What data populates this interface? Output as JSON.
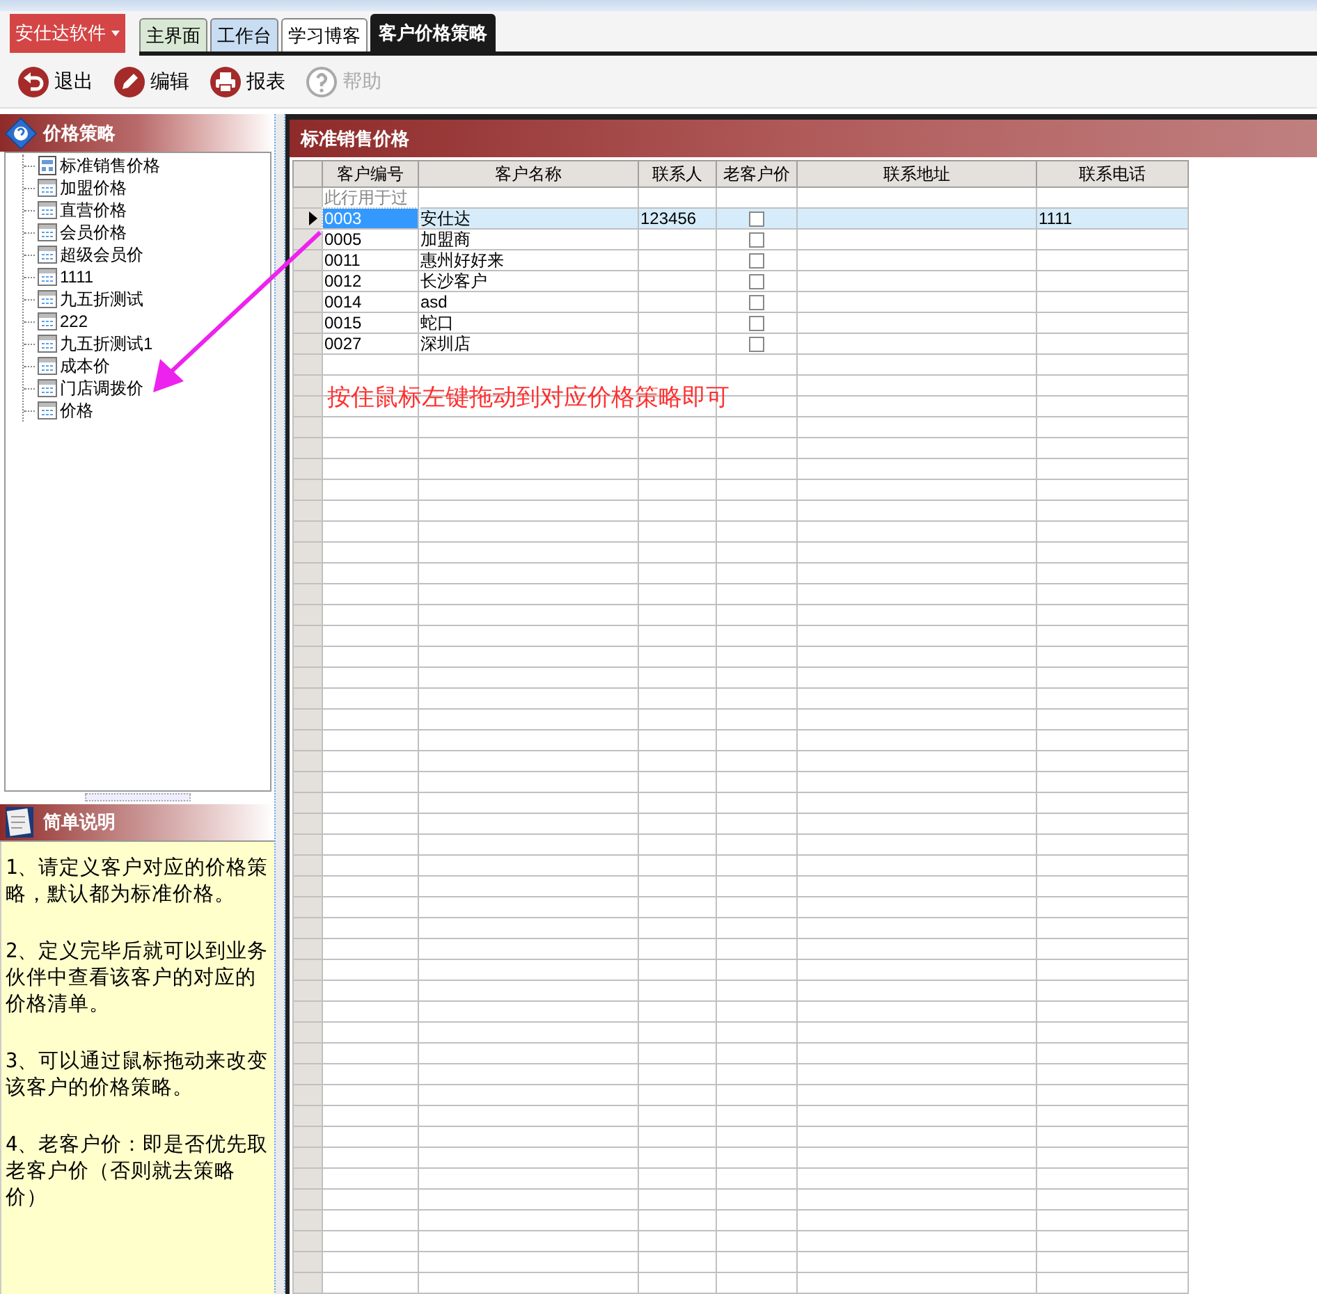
{
  "app_menu": {
    "label": "安仕达软件"
  },
  "tabs": [
    {
      "label": "主界面",
      "selected": false,
      "color": "#d8e8d4"
    },
    {
      "label": "工作台",
      "selected": false,
      "color": "#c8dcf2"
    },
    {
      "label": "学习博客",
      "selected": false,
      "color": "#ffffff"
    },
    {
      "label": "客户价格策略",
      "selected": true,
      "color": "#1a1a1a"
    }
  ],
  "toolbar": [
    {
      "label": "退出",
      "kind": "exit",
      "disabled": false
    },
    {
      "label": "编辑",
      "kind": "edit",
      "disabled": false
    },
    {
      "label": "报表",
      "kind": "print",
      "disabled": false
    },
    {
      "label": "帮助",
      "kind": "help",
      "disabled": true
    }
  ],
  "price_policy_panel": {
    "title": "价格策略",
    "items": [
      {
        "label": "标准销售价格",
        "kind": "standard"
      },
      {
        "label": "加盟价格",
        "kind": "policy"
      },
      {
        "label": "直营价格",
        "kind": "policy"
      },
      {
        "label": "会员价格",
        "kind": "policy"
      },
      {
        "label": "超级会员价",
        "kind": "policy"
      },
      {
        "label": "1111",
        "kind": "policy"
      },
      {
        "label": "九五折测试",
        "kind": "policy"
      },
      {
        "label": "222",
        "kind": "policy"
      },
      {
        "label": "九五折测试1",
        "kind": "policy"
      },
      {
        "label": "成本价",
        "kind": "policy"
      },
      {
        "label": "门店调拨价",
        "kind": "policy"
      },
      {
        "label": "价格",
        "kind": "policy"
      }
    ]
  },
  "help_panel": {
    "title": "简单说明",
    "paragraphs": [
      "1、请定义客户对应的价格策略，默认都为标准价格。",
      "2、定义完毕后就可以到业务伙伴中查看该客户的对应的价格清单。",
      "3、可以通过鼠标拖动来改变该客户的价格策略。",
      "4、老客户价：即是否优先取老客户价（否则就去策略价）"
    ]
  },
  "grid": {
    "title": "标准销售价格",
    "columns": [
      "客户编号",
      "客户名称",
      "联系人",
      "老客户价",
      "联系地址",
      "联系电话"
    ],
    "filter_hint": "此行用于过",
    "rows": [
      {
        "code": "0003",
        "name": "安仕达",
        "contact": "123456",
        "phone": "1111",
        "old_customer_price": false,
        "selected": true
      },
      {
        "code": "0005",
        "name": "加盟商",
        "old_customer_price": false,
        "selected": false
      },
      {
        "code": "0011",
        "name": "惠州好好来",
        "old_customer_price": false,
        "selected": false
      },
      {
        "code": "0012",
        "name": "长沙客户",
        "old_customer_price": false,
        "selected": false
      },
      {
        "code": "0014",
        "name": "asd",
        "old_customer_price": false,
        "selected": false
      },
      {
        "code": "0015",
        "name": "蛇口",
        "old_customer_price": false,
        "selected": false
      },
      {
        "code": "0027",
        "name": "深圳店",
        "old_customer_price": false,
        "selected": false
      }
    ]
  },
  "annotation": "按住鼠标左键拖动到对应价格策略即可"
}
